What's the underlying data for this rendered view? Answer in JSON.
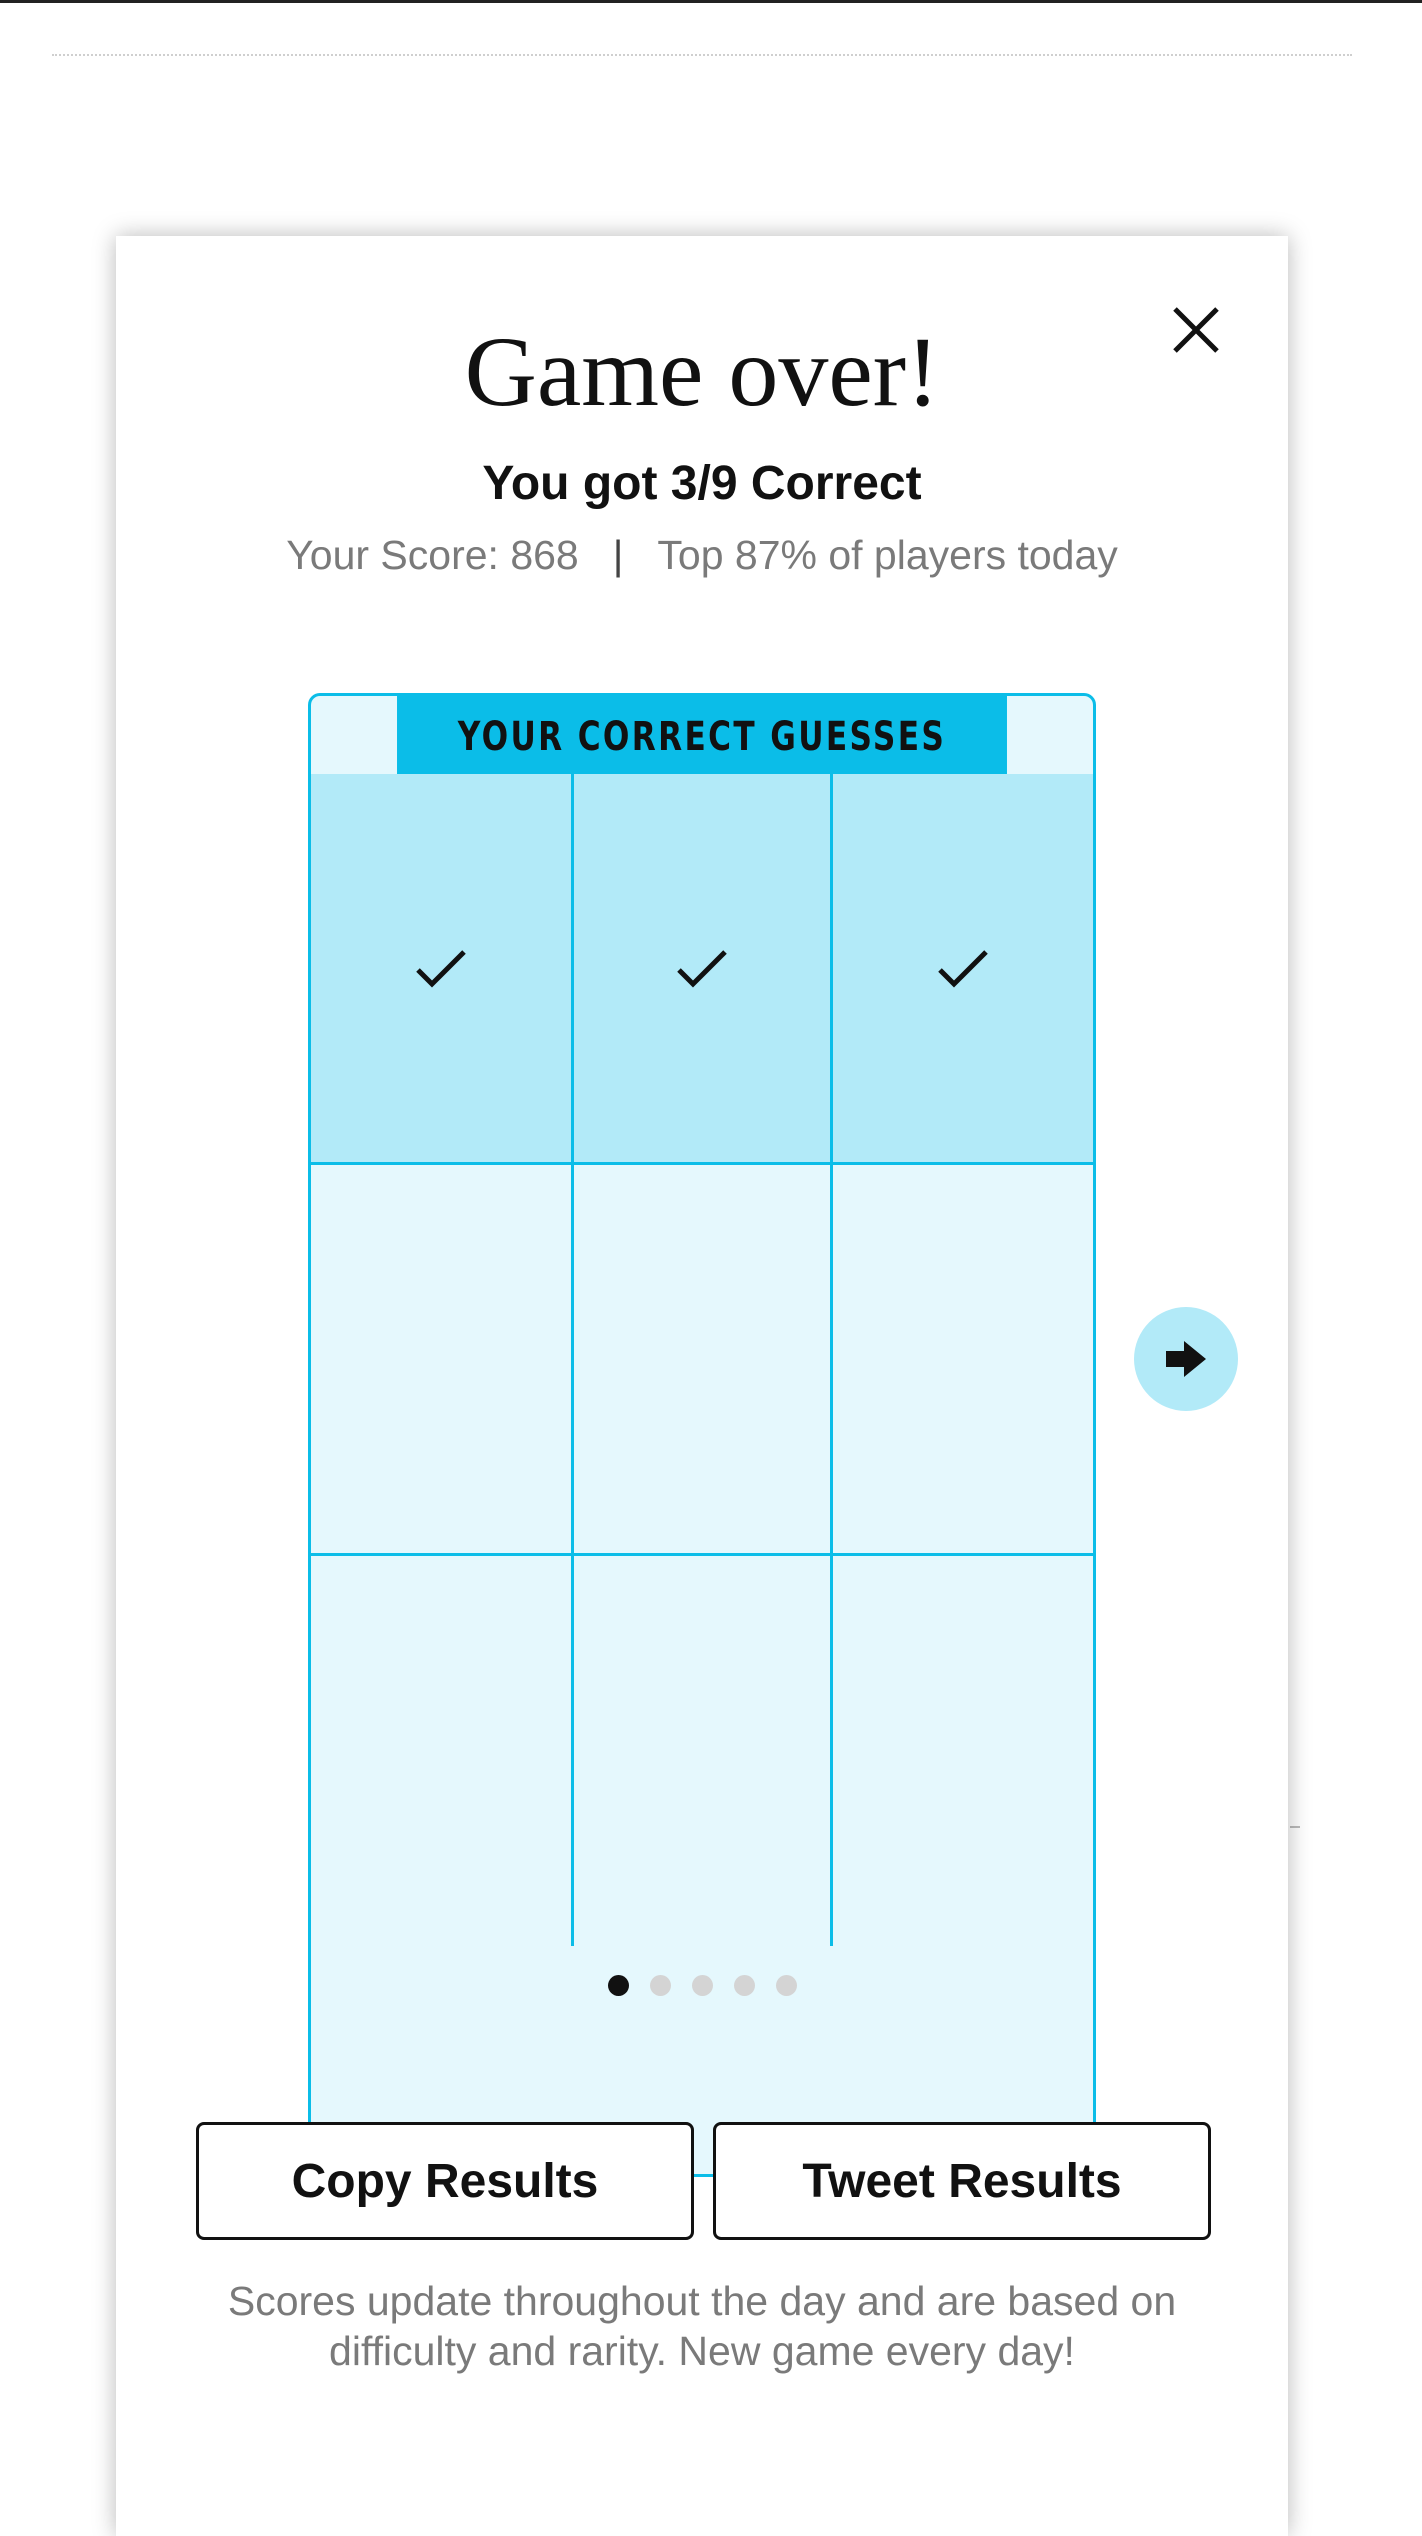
{
  "modal": {
    "title": "Game over!",
    "summary": "You got 3/9 Correct",
    "score_text": "Your Score: 868",
    "separator": "|",
    "rank_text": "Top 87% of players today"
  },
  "grid": {
    "header": "YOUR CORRECT GUESSES",
    "cells": [
      true,
      true,
      true,
      false,
      false,
      false,
      false,
      false,
      false
    ],
    "accent_color": "#0bbde8",
    "correct_fill": "#b2eaf8",
    "empty_fill": "#e5f8fd"
  },
  "pager": {
    "page_count": 5,
    "current_page": 1
  },
  "actions": {
    "copy_label": "Copy Results",
    "tweet_label": "Tweet Results"
  },
  "footnote": "Scores update throughout the day and are based on difficulty and rarity. New game every day!",
  "icons": {
    "close": "close-icon",
    "next": "arrow-right-icon",
    "check": "checkmark-icon"
  }
}
